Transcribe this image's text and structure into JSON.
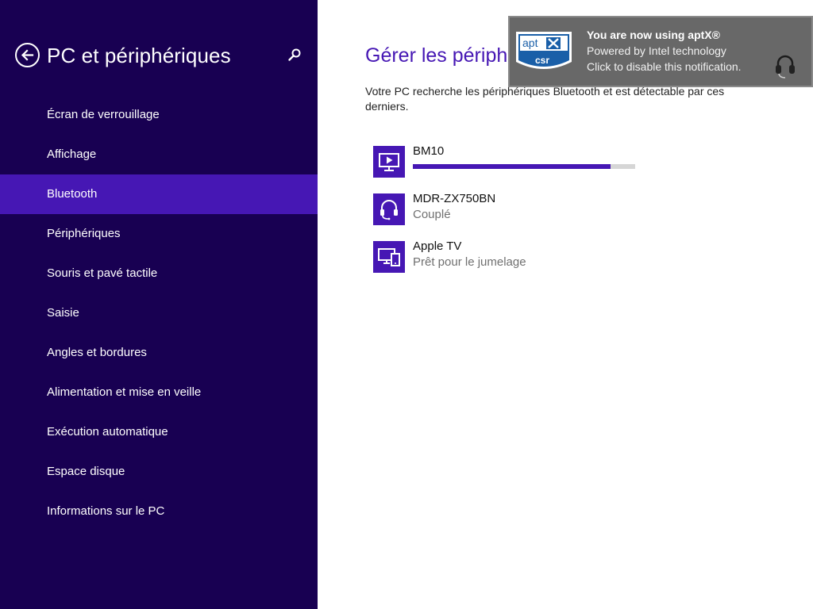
{
  "sidebar": {
    "title": "PC et périphériques",
    "items": [
      {
        "label": "Écran de verrouillage",
        "active": false
      },
      {
        "label": "Affichage",
        "active": false
      },
      {
        "label": "Bluetooth",
        "active": true
      },
      {
        "label": "Périphériques",
        "active": false
      },
      {
        "label": "Souris et pavé tactile",
        "active": false
      },
      {
        "label": "Saisie",
        "active": false
      },
      {
        "label": "Angles et bordures",
        "active": false
      },
      {
        "label": "Alimentation et mise en veille",
        "active": false
      },
      {
        "label": "Exécution automatique",
        "active": false
      },
      {
        "label": "Espace disque",
        "active": false
      },
      {
        "label": "Informations sur le PC",
        "active": false
      }
    ]
  },
  "main": {
    "title": "Gérer les périphé",
    "description": "Votre PC recherche les périphériques Bluetooth et est détectable par ces derniers.",
    "devices": [
      {
        "name": "BM10",
        "status": "",
        "icon": "display-play-icon",
        "progress": 0.89
      },
      {
        "name": "MDR-ZX750BN",
        "status": "Couplé",
        "icon": "headset-icon"
      },
      {
        "name": "Apple TV",
        "status": "Prêt pour le jumelage",
        "icon": "devices-icon"
      }
    ]
  },
  "toast": {
    "title": "You are now using aptX®",
    "line1": "Powered by Intel technology",
    "line2": "Click to disable this notification.",
    "logo": "aptx-csr-logo",
    "icon": "headset-icon"
  },
  "colors": {
    "sidebar_bg": "#180052",
    "accent": "#4617b4",
    "toast_bg": "#686868"
  }
}
